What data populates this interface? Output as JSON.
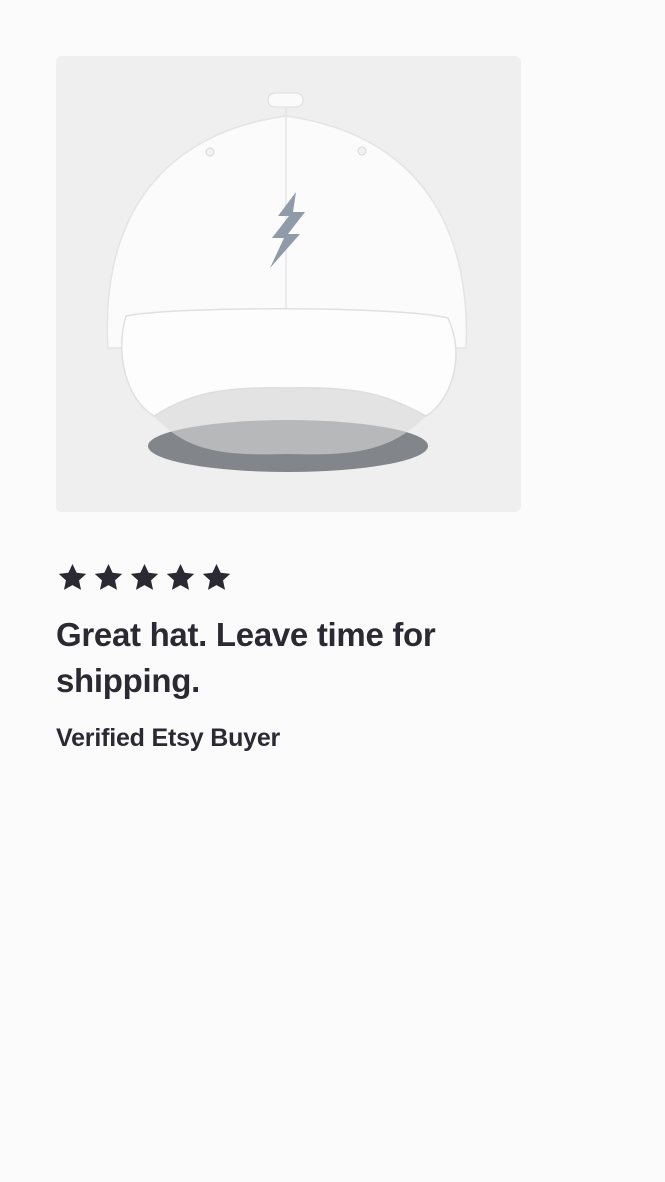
{
  "review": {
    "product_image": "white-dad-hat-with-gray-lightning-bolt-embroidery",
    "rating": 5,
    "rating_max": 5,
    "text": "Great hat. Leave time for shipping.",
    "reviewer": "Verified Etsy Buyer"
  },
  "colors": {
    "page_background": "#fcfbfc",
    "image_background": "#efefef",
    "text": "#2b2a33",
    "star": "#2b2a33",
    "bolt": "#8f9ba8"
  },
  "icons": {
    "star": "star-icon"
  }
}
